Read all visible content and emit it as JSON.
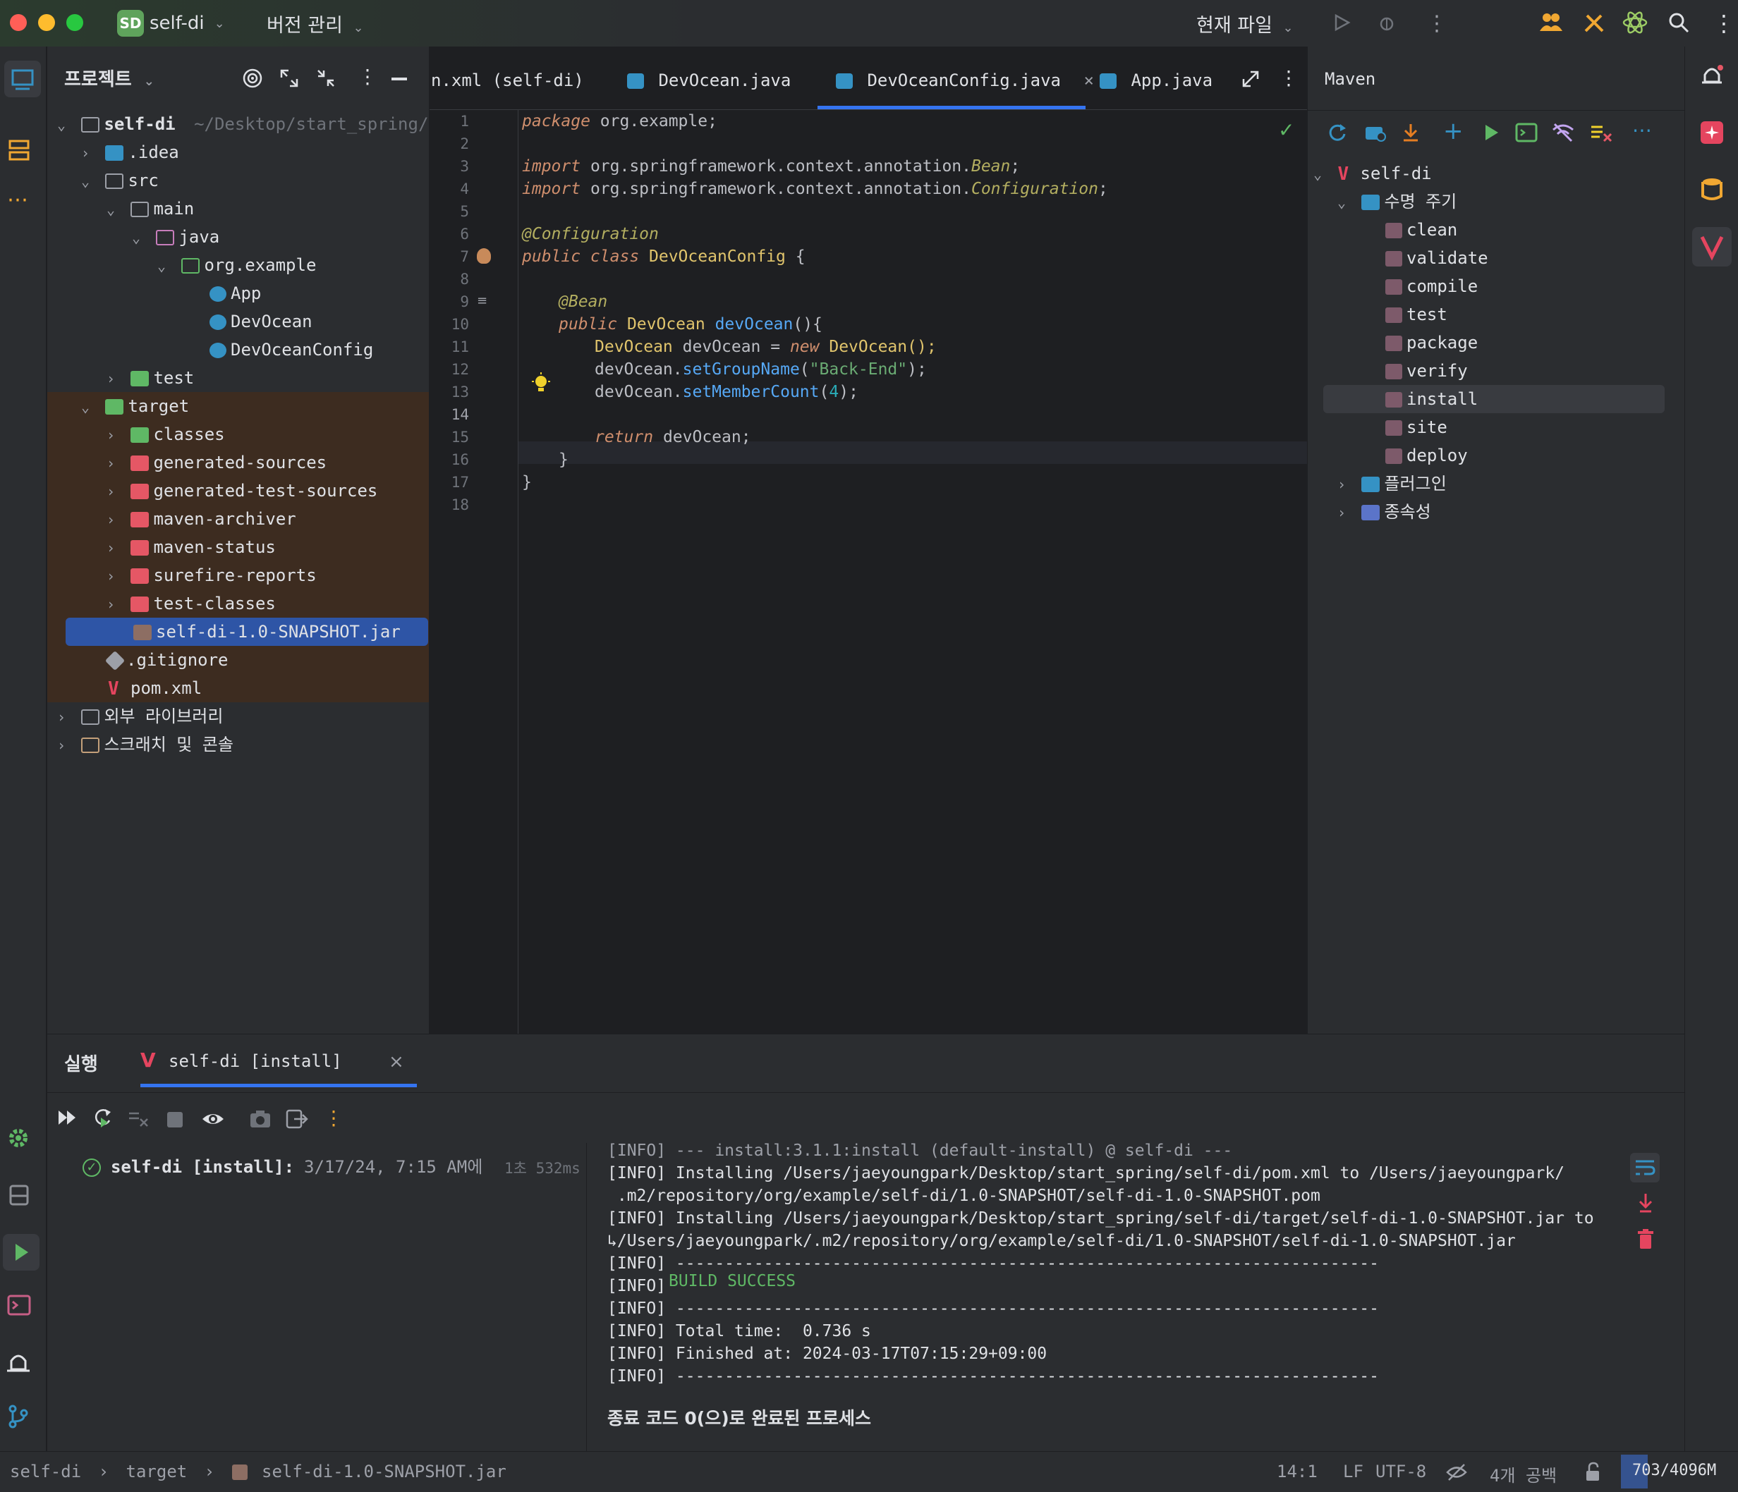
{
  "titlebar": {
    "project_badge": "SD",
    "project_name": "self-di",
    "vcs_label": "버전 관리",
    "run_config": "현재 파일"
  },
  "project_panel": {
    "title": "프로젝트",
    "root_name": "self-di",
    "root_path": "~/Desktop/start_spring/sel",
    "items": [
      {
        "label": ".idea"
      },
      {
        "label": "src"
      },
      {
        "label": "main"
      },
      {
        "label": "java"
      },
      {
        "label": "org.example"
      },
      {
        "label": "App"
      },
      {
        "label": "DevOcean"
      },
      {
        "label": "DevOceanConfig"
      },
      {
        "label": "test"
      },
      {
        "label": "target"
      },
      {
        "label": "classes"
      },
      {
        "label": "generated-sources"
      },
      {
        "label": "generated-test-sources"
      },
      {
        "label": "maven-archiver"
      },
      {
        "label": "maven-status"
      },
      {
        "label": "surefire-reports"
      },
      {
        "label": "test-classes"
      },
      {
        "label": "self-di-1.0-SNAPSHOT.jar"
      },
      {
        "label": ".gitignore"
      },
      {
        "label": "pom.xml"
      },
      {
        "label": "외부 라이브러리"
      },
      {
        "label": "스크래치 및 콘솔"
      }
    ]
  },
  "editor": {
    "tabs": [
      {
        "label": "n.xml (self-di)"
      },
      {
        "label": "DevOcean.java"
      },
      {
        "label": "DevOceanConfig.java"
      },
      {
        "label": "App.java"
      }
    ],
    "line_numbers": [
      "1",
      "2",
      "3",
      "4",
      "5",
      "6",
      "7",
      "8",
      "9",
      "10",
      "11",
      "12",
      "13",
      "14",
      "15",
      "16",
      "17",
      "18"
    ],
    "code": {
      "l1_kw": "package",
      "l1_rest": " org.example;",
      "l3_kw": "import",
      "l3_pkg": " org.springframework.context.annotation.",
      "l3_cls": "Bean",
      "l3_end": ";",
      "l4_kw": "import",
      "l4_pkg": " org.springframework.context.annotation.",
      "l4_cls": "Configuration",
      "l4_end": ";",
      "l6": "@Configuration",
      "l7_kw": "public class",
      "l7_name": " DevOceanConfig",
      "l7_end": " {",
      "l9": "@Bean",
      "l10_kw": "public",
      "l10_type": " DevOcean ",
      "l10_fn": "devOcean",
      "l10_end": "(){",
      "l11_type": "DevOcean",
      "l11_var": " devOcean = ",
      "l11_kw": "new",
      "l11_end": " DevOcean();",
      "l12_var": "devOcean.",
      "l12_fn": "setGroupName",
      "l12_p1": "(",
      "l12_str": "\"Back-End\"",
      "l12_p2": ");",
      "l13_var": "devOcean.",
      "l13_fn": "setMemberCount",
      "l13_p1": "(",
      "l13_num": "4",
      "l13_p2": ");",
      "l15_kw": "return",
      "l15_rest": " devOcean;",
      "l16": "}",
      "l17": "}"
    }
  },
  "maven": {
    "title": "Maven",
    "root": "self-di",
    "lifecycle_label": "수명 주기",
    "goals": [
      "clean",
      "validate",
      "compile",
      "test",
      "package",
      "verify",
      "install",
      "site",
      "deploy"
    ],
    "plugins_label": "플러그인",
    "dependencies_label": "종속성"
  },
  "run_panel": {
    "title": "실행",
    "tab_label": "self-di [install]",
    "entry_label": "self-di [install]:",
    "entry_time": "3/17/24, 7:15 AM에",
    "entry_duration": "1초 532ms",
    "console": [
      "[INFO] --- install:3.1.1:install (default-install) @ self-di ---",
      "[INFO] Installing /Users/jaeyoungpark/Desktop/start_spring/self-di/pom.xml to /Users/jaeyoungpark/",
      " .m2/repository/org/example/self-di/1.0-SNAPSHOT/self-di-1.0-SNAPSHOT.pom",
      "[INFO] Installing /Users/jaeyoungpark/Desktop/start_spring/self-di/target/self-di-1.0-SNAPSHOT.jar to",
      "↳/Users/jaeyoungpark/.m2/repository/org/example/self-di/1.0-SNAPSHOT/self-di-1.0-SNAPSHOT.jar",
      "[INFO] ------------------------------------------------------------------------",
      "[INFO] ",
      "[INFO] ------------------------------------------------------------------------",
      "[INFO] Total time:  0.736 s",
      "[INFO] Finished at: 2024-03-17T07:15:29+09:00",
      "[INFO] ------------------------------------------------------------------------"
    ],
    "build_success": "BUILD SUCCESS",
    "exit_message": "종료 코드 0(으)로 완료된 프로세스"
  },
  "statusbar": {
    "crumb_root": "self-di",
    "crumb_folder": "target",
    "crumb_file": "self-di-1.0-SNAPSHOT.jar",
    "position": "14:1",
    "line_sep": "LF",
    "encoding": "UTF-8",
    "indent": "4개 공백",
    "memory": "703/4096M"
  },
  "colors": {
    "accent": "#3574f0",
    "selection": "#2e436e",
    "excluded_bg": "#3d2c20"
  }
}
